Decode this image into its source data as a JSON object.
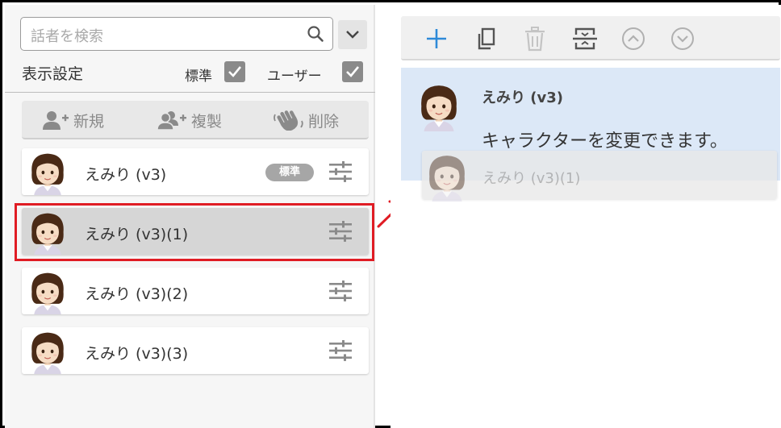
{
  "left_panel": {
    "search": {
      "placeholder": "話者を検索",
      "icon": "search-icon"
    },
    "display_settings": {
      "label": "表示設定",
      "standard_label": "標準",
      "standard_checked": true,
      "user_label": "ユーザー",
      "user_checked": true
    },
    "toolbar": {
      "new_label": "新規",
      "duplicate_label": "複製",
      "delete_label": "削除"
    },
    "characters": [
      {
        "name": "えみり (v3)",
        "badge": "標準",
        "selected": false
      },
      {
        "name": "えみり (v3)(1)",
        "selected": true
      },
      {
        "name": "えみり (v3)(2)",
        "selected": false
      },
      {
        "name": "えみり (v3)(3)",
        "selected": false
      }
    ]
  },
  "right_panel": {
    "toolbar_icons": [
      "plus-icon",
      "copy-icon",
      "trash-icon",
      "split-icon",
      "chevron-up-icon",
      "chevron-down-icon"
    ],
    "talk_card": {
      "name": "えみり (v3)",
      "text": "キャラクターを変更できます。"
    },
    "drag_ghost": {
      "name": "えみり (v3)(1)"
    }
  },
  "colors": {
    "highlight": "#e01c24",
    "accent": "#2e8ad8",
    "card_bg": "#dce8f7"
  }
}
